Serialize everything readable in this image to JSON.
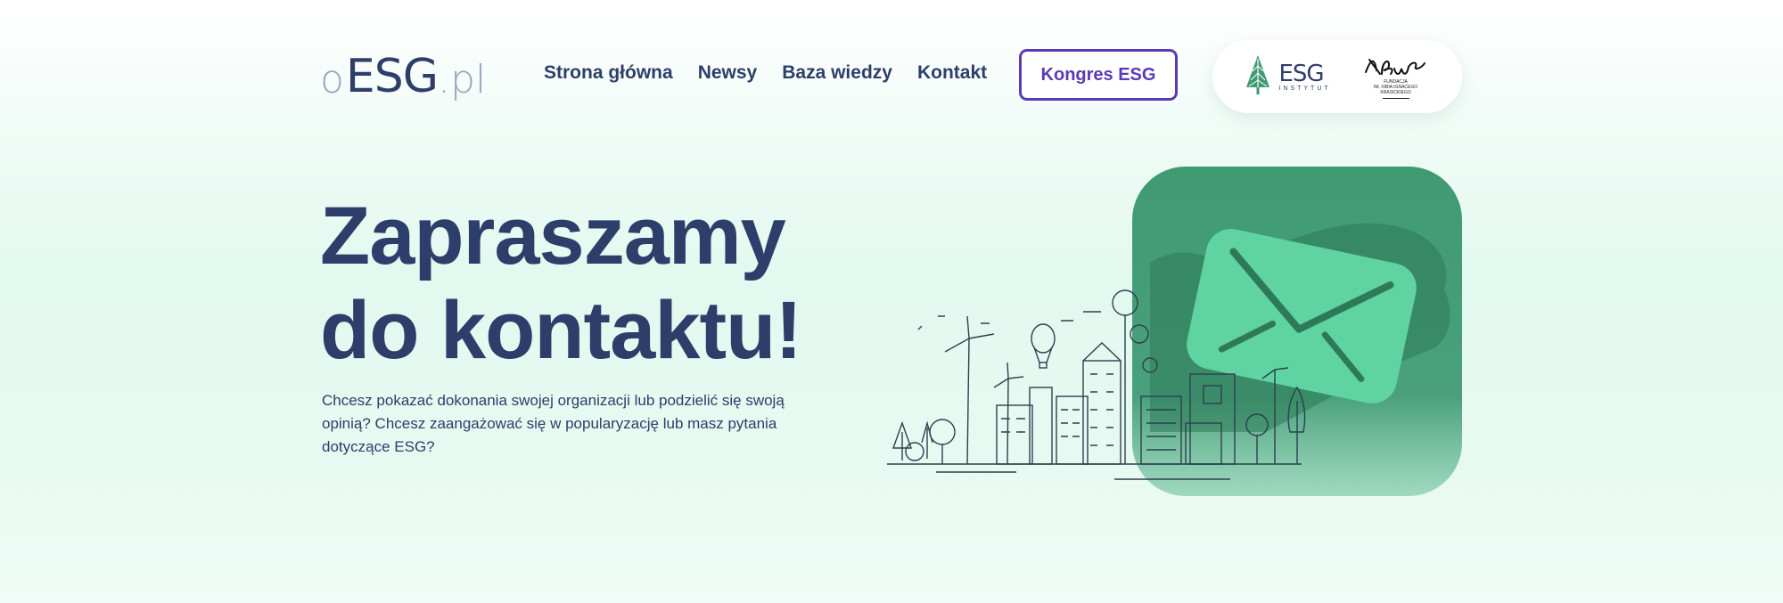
{
  "logo": {
    "o": "o",
    "esg": "ESG",
    "pl": ".pl"
  },
  "nav": {
    "items": [
      {
        "label": "Strona główna"
      },
      {
        "label": "Newsy"
      },
      {
        "label": "Baza wiedzy"
      },
      {
        "label": "Kontakt"
      }
    ],
    "cta_label": "Kongres ESG"
  },
  "partners": {
    "esg_institute": {
      "name": "ESG",
      "subtitle": "INSTYTUT"
    },
    "foundation": {
      "caption_line1": "FUNDACJA",
      "caption_line2": "IM. XIBIA IGNACEGO KRASICKIEGO"
    }
  },
  "hero": {
    "title_line1": "Zapraszamy",
    "title_line2": "do kontaktu!",
    "lead": "Chcesz pokazać dokonania swojej organizacji lub podzielić się swoją opinią? Chcesz zaangażować się w popularyzację lub masz pytania dotyczące ESG?"
  },
  "colors": {
    "navy": "#2d3e6b",
    "purple": "#5b3ab8",
    "green_dark": "#3f9a72",
    "green_light": "#5fd3a2",
    "logo_grey": "#9aa5bd"
  }
}
